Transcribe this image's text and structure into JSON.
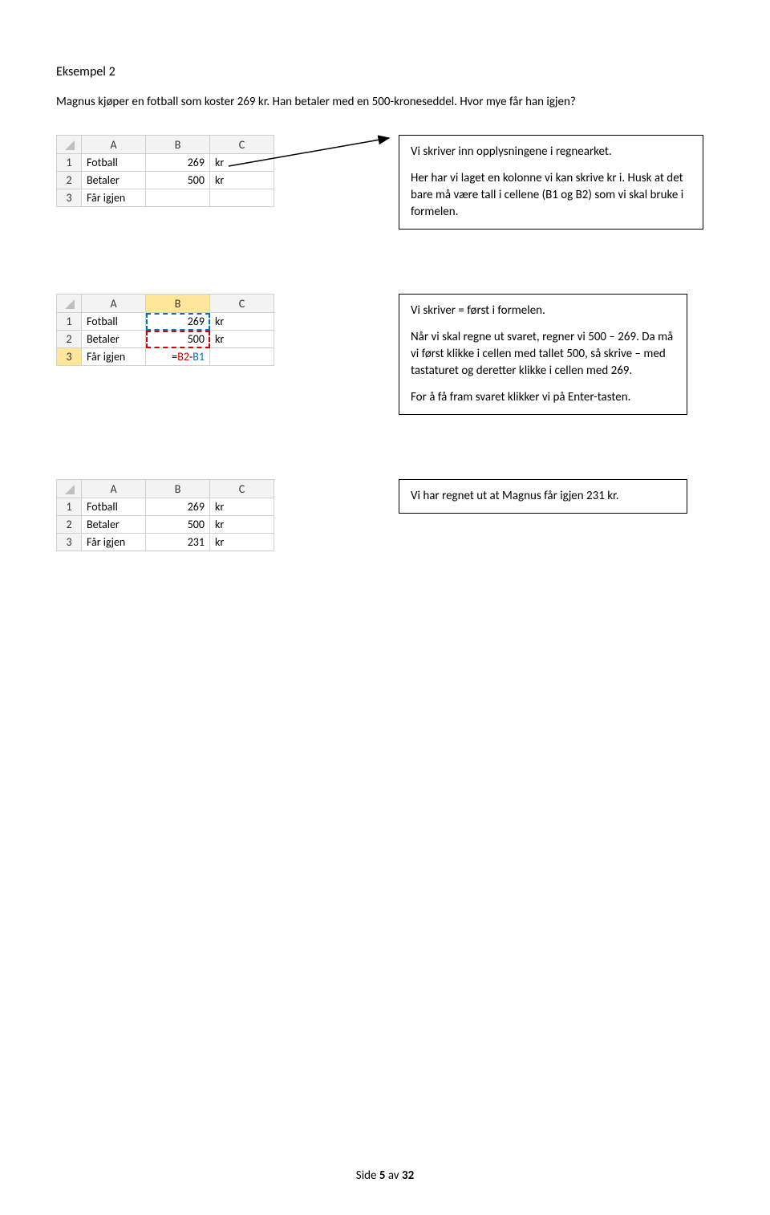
{
  "heading": "Eksempel 2",
  "intro": "Magnus kjøper en fotball som koster 269 kr. Han betaler med en 500-kroneseddel. Hvor mye får han igjen?",
  "sheets": {
    "cols": [
      "A",
      "B",
      "C"
    ],
    "s1": {
      "rows": [
        {
          "n": "1",
          "a": "Fotball",
          "b": "269",
          "c": "kr"
        },
        {
          "n": "2",
          "a": "Betaler",
          "b": "500",
          "c": "kr"
        },
        {
          "n": "3",
          "a": "Får igjen",
          "b": "",
          "c": ""
        }
      ]
    },
    "s2": {
      "rows": [
        {
          "n": "1",
          "a": "Fotball",
          "b": "269",
          "c": "kr"
        },
        {
          "n": "2",
          "a": "Betaler",
          "b": "500",
          "c": "kr"
        },
        {
          "n": "3",
          "a": "Får igjen",
          "b_formula_prefix": "=",
          "b_formula_ref1": "B2",
          "b_formula_dash": "-",
          "b_formula_ref2": "B1",
          "c": ""
        }
      ]
    },
    "s3": {
      "rows": [
        {
          "n": "1",
          "a": "Fotball",
          "b": "269",
          "c": "kr"
        },
        {
          "n": "2",
          "a": "Betaler",
          "b": "500",
          "c": "kr"
        },
        {
          "n": "3",
          "a": "Får igjen",
          "b": "231",
          "c": "kr"
        }
      ]
    }
  },
  "callout1": {
    "p1": "Vi skriver inn opplysningene i regnearket.",
    "p2": "Her har vi laget en kolonne vi kan skrive kr i. Husk at det bare må være tall i cellene (B1 og B2) som vi skal bruke i formelen."
  },
  "callout2": {
    "p1": "Vi skriver = først i formelen.",
    "p2": "Når vi skal regne ut svaret, regner vi 500 – 269. Da må vi først klikke i cellen med tallet 500, så skrive – med tastaturet og deretter klikke i cellen med 269.",
    "p3": "For å få fram svaret klikker vi på Enter-tasten."
  },
  "callout3": {
    "p1": "Vi har regnet ut at Magnus får igjen 231 kr."
  },
  "footer": {
    "prefix": "Side ",
    "page": "5",
    "mid": " av ",
    "total": "32"
  }
}
